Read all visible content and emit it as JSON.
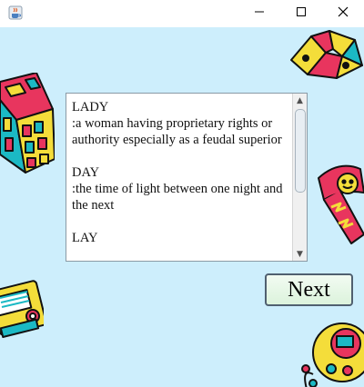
{
  "window": {
    "icon": "java-cup-icon",
    "controls": [
      "minimize-icon",
      "maximize-icon",
      "close-icon"
    ]
  },
  "definitions": {
    "entries": [
      {
        "word": "LADY",
        "definition": ":a woman having proprietary rights or authority especially as a feudal superior"
      },
      {
        "word": "DAY",
        "definition": ":the time of light between one night and the next"
      },
      {
        "word": "LAY",
        "definition": ""
      }
    ],
    "scroll_fraction": 0.0
  },
  "next_button": {
    "label": "Next"
  },
  "decorations": [
    "rubiks-cube-icon",
    "paper-fortune-teller-icon",
    "cassette-tape-icon",
    "walkman-icon",
    "tamagotchi-icon"
  ],
  "colors": {
    "background": "#cdeefc",
    "button_fill": "#dcf3dc"
  }
}
